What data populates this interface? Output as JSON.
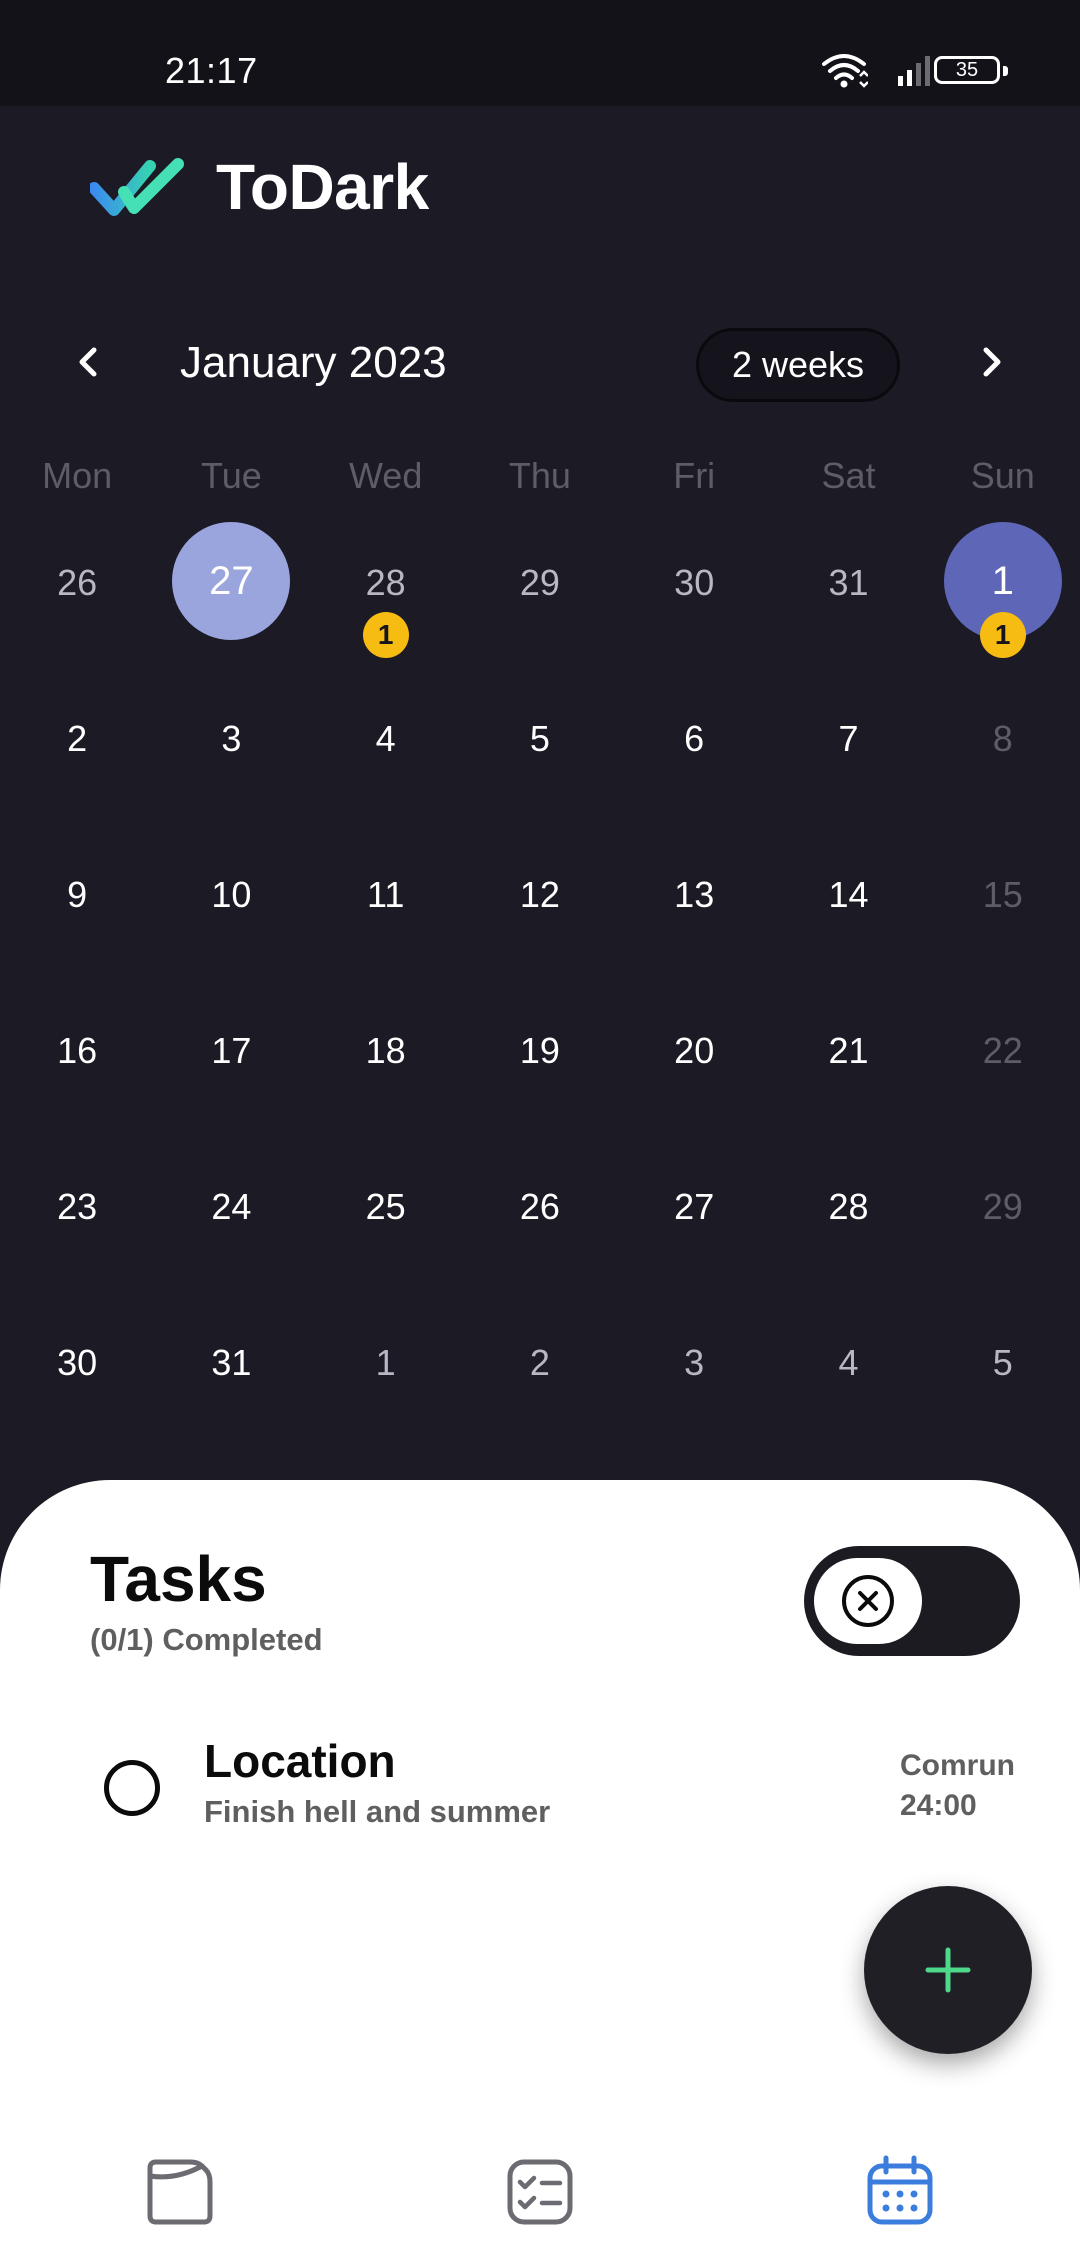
{
  "status_bar": {
    "time": "21:17",
    "battery": "35"
  },
  "header": {
    "app_title": "ToDark"
  },
  "calendar": {
    "month_label": "January 2023",
    "range_label": "2 weeks",
    "weekdays": [
      "Mon",
      "Tue",
      "Wed",
      "Thu",
      "Fri",
      "Sat",
      "Sun"
    ],
    "weeks": [
      [
        {
          "label": "26",
          "style": "muted"
        },
        {
          "label": "27",
          "style": "today"
        },
        {
          "label": "28",
          "style": "muted",
          "badge": "1"
        },
        {
          "label": "29",
          "style": "muted"
        },
        {
          "label": "30",
          "style": "muted"
        },
        {
          "label": "31",
          "style": "muted"
        },
        {
          "label": "1",
          "style": "selected",
          "badge": "1"
        }
      ],
      [
        {
          "label": "2"
        },
        {
          "label": "3"
        },
        {
          "label": "4"
        },
        {
          "label": "5"
        },
        {
          "label": "6"
        },
        {
          "label": "7"
        },
        {
          "label": "8",
          "style": "dim"
        }
      ],
      [
        {
          "label": "9"
        },
        {
          "label": "10"
        },
        {
          "label": "11"
        },
        {
          "label": "12"
        },
        {
          "label": "13"
        },
        {
          "label": "14"
        },
        {
          "label": "15",
          "style": "dim"
        }
      ],
      [
        {
          "label": "16"
        },
        {
          "label": "17"
        },
        {
          "label": "18"
        },
        {
          "label": "19"
        },
        {
          "label": "20"
        },
        {
          "label": "21"
        },
        {
          "label": "22",
          "style": "dim"
        }
      ],
      [
        {
          "label": "23"
        },
        {
          "label": "24"
        },
        {
          "label": "25"
        },
        {
          "label": "26"
        },
        {
          "label": "27"
        },
        {
          "label": "28"
        },
        {
          "label": "29",
          "style": "dim"
        }
      ],
      [
        {
          "label": "30"
        },
        {
          "label": "31"
        },
        {
          "label": "1",
          "style": "muted"
        },
        {
          "label": "2",
          "style": "muted"
        },
        {
          "label": "3",
          "style": "muted"
        },
        {
          "label": "4",
          "style": "muted"
        },
        {
          "label": "5",
          "style": "muted"
        }
      ]
    ]
  },
  "tasks": {
    "title": "Tasks",
    "subtitle": "(0/1) Completed",
    "items": [
      {
        "title": "Location",
        "description": "Finish hell and summer",
        "meta_line1": "Comrun",
        "meta_line2": "24:00"
      }
    ]
  },
  "bottom_nav": {
    "items": [
      {
        "icon": "notes-icon",
        "active": false
      },
      {
        "icon": "checklist-icon",
        "active": false
      },
      {
        "icon": "calendar-icon",
        "active": true
      }
    ]
  },
  "colors": {
    "background": "#1c1b25",
    "today": "#9aa4dd",
    "selected": "#5e66b8",
    "badge": "#f6bc12",
    "fab_plus": "#4ed88a",
    "nav_active": "#3b7ddd",
    "nav_inactive": "#6b6b72"
  }
}
